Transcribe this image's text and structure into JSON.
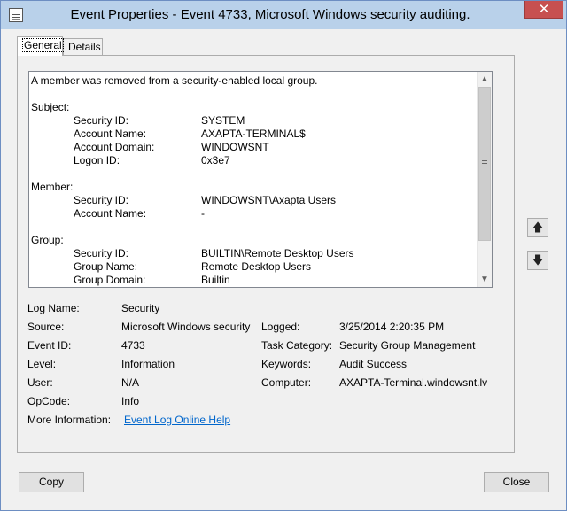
{
  "window": {
    "title": "Event Properties - Event 4733, Microsoft Windows security auditing.",
    "close_glyph": "✕"
  },
  "tabs": [
    {
      "label": "General",
      "active": true
    },
    {
      "label": "Details",
      "active": false
    }
  ],
  "description": {
    "summary": "A member was removed from a security-enabled local group.",
    "subject_header": "Subject:",
    "subject": [
      {
        "key": "Security ID:",
        "value": "SYSTEM"
      },
      {
        "key": "Account Name:",
        "value": "AXAPTA-TERMINAL$"
      },
      {
        "key": "Account Domain:",
        "value": "WINDOWSNT"
      },
      {
        "key": "Logon ID:",
        "value": "0x3e7"
      }
    ],
    "member_header": "Member:",
    "member": [
      {
        "key": "Security ID:",
        "value": "WINDOWSNT\\Axapta Users"
      },
      {
        "key": "Account Name:",
        "value": "-"
      }
    ],
    "group_header": "Group:",
    "group": [
      {
        "key": "Security ID:",
        "value": "BUILTIN\\Remote Desktop Users"
      },
      {
        "key": "Group Name:",
        "value": "Remote Desktop Users"
      },
      {
        "key": "Group Domain:",
        "value": "Builtin"
      }
    ]
  },
  "fields": {
    "log_name_label": "Log Name:",
    "log_name": "Security",
    "source_label": "Source:",
    "source": "Microsoft Windows security",
    "logged_label": "Logged:",
    "logged": "3/25/2014 2:20:35 PM",
    "event_id_label": "Event ID:",
    "event_id": "4733",
    "task_category_label": "Task Category:",
    "task_category": "Security Group Management",
    "level_label": "Level:",
    "level": "Information",
    "keywords_label": "Keywords:",
    "keywords": "Audit Success",
    "user_label": "User:",
    "user": "N/A",
    "computer_label": "Computer:",
    "computer": "AXAPTA-Terminal.windowsnt.lv",
    "opcode_label": "OpCode:",
    "opcode": "Info",
    "more_info_label": "More Information:",
    "more_info_link": "Event Log Online Help"
  },
  "nav": {
    "up_glyph": "🡅",
    "down_glyph": "🡇"
  },
  "buttons": {
    "copy": "Copy",
    "close": "Close"
  }
}
